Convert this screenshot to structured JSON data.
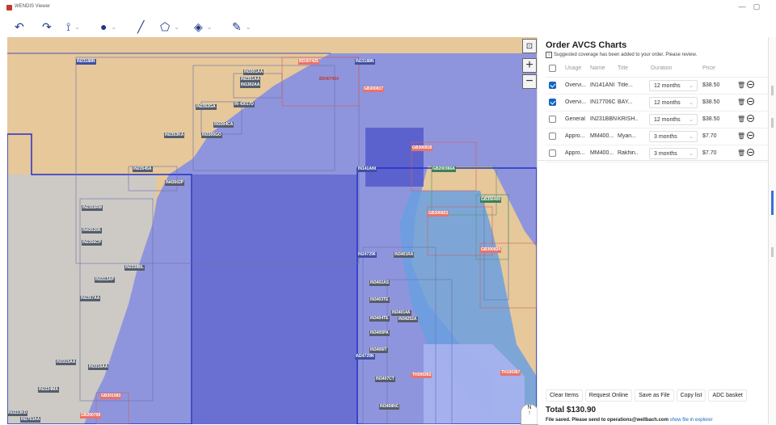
{
  "window": {
    "title": "WENDIS Viewer",
    "controls": [
      "—",
      "▢"
    ]
  },
  "toolbar": [
    {
      "icon": "undo-icon",
      "glyph": "↶"
    },
    {
      "icon": "redo-icon",
      "glyph": "↷"
    },
    {
      "icon": "route-icon",
      "glyph": "⟟",
      "dropdown": true
    },
    {
      "icon": "pin-icon",
      "glyph": "●",
      "dropdown": true
    },
    {
      "icon": "line-icon",
      "glyph": "╱"
    },
    {
      "icon": "polygon-icon",
      "glyph": "⬠",
      "dropdown": true
    },
    {
      "icon": "layers-icon",
      "glyph": "◈",
      "dropdown": true
    },
    {
      "icon": "select-icon",
      "glyph": "✎",
      "dropdown": true
    }
  ],
  "map": {
    "colors": {
      "land": "#e6c89a",
      "sea": "#8f95dc",
      "selected": "#4b52c8",
      "gray": "#c8cacd"
    },
    "labels": [
      {
        "text": "IN23188N",
        "style": "blue"
      },
      {
        "text": "IN23188N",
        "style": "blue"
      },
      {
        "text": "BD307425",
        "style": "red"
      },
      {
        "text": "BD407454",
        "style": "redtext"
      },
      {
        "text": "IN3301AA",
        "style": "gray"
      },
      {
        "text": "IN2351AA",
        "style": "gray"
      },
      {
        "text": "IN1302AA",
        "style": "gray"
      },
      {
        "text": "GB300817",
        "style": "red"
      },
      {
        "text": "IN 43017D",
        "style": "gray"
      },
      {
        "text": "IN2352GA",
        "style": "gray"
      },
      {
        "text": "IN3304CA",
        "style": "gray"
      },
      {
        "text": "IN3305GO",
        "style": "gray"
      },
      {
        "text": "IN2353KA",
        "style": "gray"
      },
      {
        "text": "GB300818",
        "style": "red"
      },
      {
        "text": "IN141ANI",
        "style": "blue"
      },
      {
        "text": "GB200366A",
        "style": "green"
      },
      {
        "text": "IN23545A",
        "style": "gray"
      },
      {
        "text": "IN43002P",
        "style": "gray"
      },
      {
        "text": "GB356400",
        "style": "green"
      },
      {
        "text": "IN2355RM",
        "style": "gray"
      },
      {
        "text": "GB300823",
        "style": "red"
      },
      {
        "text": "IN43026N",
        "style": "gray"
      },
      {
        "text": "IN2356CP",
        "style": "gray"
      },
      {
        "text": "IN247296",
        "style": "blue"
      },
      {
        "text": "IN3401RA",
        "style": "gray"
      },
      {
        "text": "GB300824",
        "style": "red"
      },
      {
        "text": "IN2338BL",
        "style": "gray"
      },
      {
        "text": "IN3313AP",
        "style": "gray"
      },
      {
        "text": "IN3402AS",
        "style": "gray"
      },
      {
        "text": "IN2357AA",
        "style": "gray"
      },
      {
        "text": "IN3403TE",
        "style": "gray"
      },
      {
        "text": "IN34014A",
        "style": "gray"
      },
      {
        "text": "IN3404TE",
        "style": "gray"
      },
      {
        "text": "IN34252A",
        "style": "gray"
      },
      {
        "text": "IN3405PA",
        "style": "gray"
      },
      {
        "text": "IN3406IT",
        "style": "gray"
      },
      {
        "text": "IN24729N",
        "style": "blue"
      },
      {
        "text": "IN3315AA",
        "style": "gray"
      },
      {
        "text": "IN3316AA",
        "style": "gray"
      },
      {
        "text": "IN3407CT",
        "style": "gray"
      },
      {
        "text": "TH200362",
        "style": "red"
      },
      {
        "text": "TH100387",
        "style": "red"
      },
      {
        "text": "IN2224MA",
        "style": "gray"
      },
      {
        "text": "GB301583",
        "style": "red"
      },
      {
        "text": "IN3408NC",
        "style": "gray"
      },
      {
        "text": "IN3223KD",
        "style": "gray"
      },
      {
        "text": "GB200799",
        "style": "red"
      },
      {
        "text": "IN2763AA",
        "style": "gray"
      }
    ],
    "compass_letter": "N"
  },
  "order": {
    "title": "Order AVCS Charts",
    "notice": "Suggested coverage has been added to your order. Please review.",
    "columns": {
      "usage": "Usage",
      "name": "Name",
      "title": "Title",
      "duration": "Duration",
      "price": "Price"
    },
    "rows": [
      {
        "checked": true,
        "usage": "Overvi...",
        "name": "IN141ANI",
        "title": "Title...",
        "duration": "12 months",
        "price": "$38.50"
      },
      {
        "checked": true,
        "usage": "Overvi...",
        "name": "IN17706C",
        "title": "BAY...",
        "duration": "12 months",
        "price": "$38.50"
      },
      {
        "checked": false,
        "usage": "General",
        "name": "IN231BBN",
        "title": "KRISH...",
        "duration": "12 months",
        "price": "$38.50"
      },
      {
        "checked": false,
        "usage": "Appro...",
        "name": "MM400...",
        "title": "Myan...",
        "duration": "3 months",
        "price": "$7.70"
      },
      {
        "checked": false,
        "usage": "Appro...",
        "name": "MM400...",
        "title": "Rakhin...",
        "duration": "3 months",
        "price": "$7.70"
      }
    ],
    "actions": [
      "Clear Items",
      "Request Online",
      "Save as File",
      "Copy list",
      "ADC basket"
    ],
    "total": "Total $130.90",
    "status_bold": "File saved. Please send to operations@wellbach.com",
    "status_link": "show file in explorer"
  }
}
